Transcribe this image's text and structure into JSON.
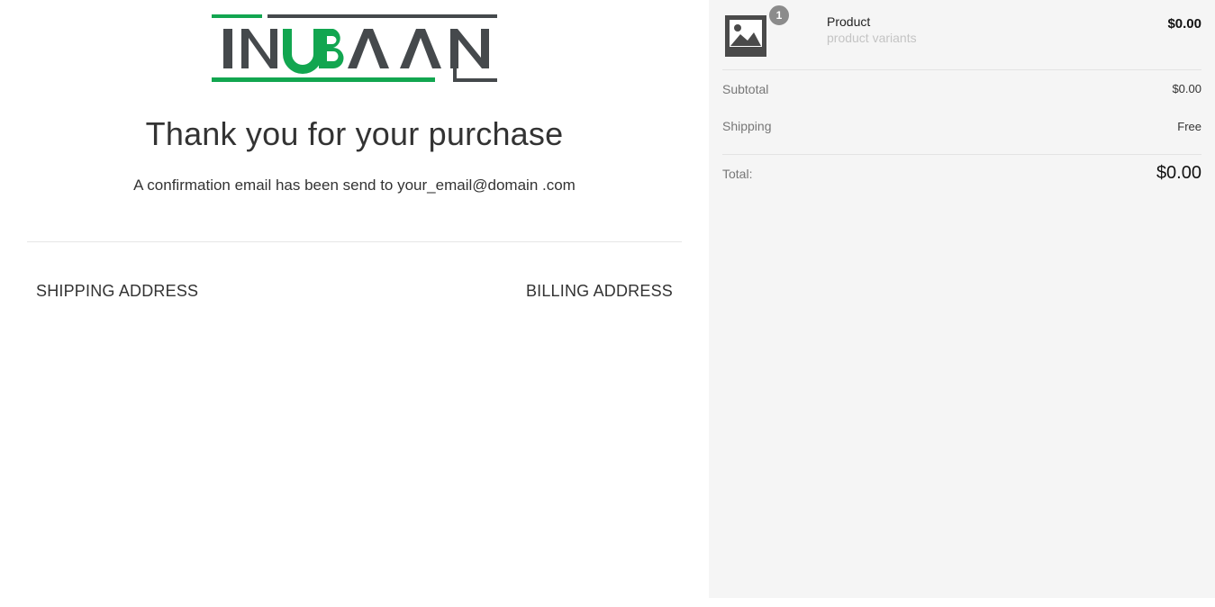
{
  "brand": {
    "logo_text": "INUBAAN",
    "primary_color": "#12a650",
    "secondary_color": "#45494c"
  },
  "confirmation": {
    "heading": "Thank you for your purchase",
    "message": "A confirmation email has been send to your_email@domain .com"
  },
  "addresses": {
    "shipping_title": "SHIPPING ADDRESS",
    "billing_title": "BILLING ADDRESS"
  },
  "order_summary": {
    "item": {
      "quantity": "1",
      "name": "Product",
      "variants": "product variants",
      "price": "$0.00",
      "image_icon": "image-placeholder-icon"
    },
    "subtotal_label": "Subtotal",
    "subtotal_value": "$0.00",
    "shipping_label": "Shipping",
    "shipping_value": "Free",
    "total_label": "Total:",
    "total_value": "$0.00"
  }
}
